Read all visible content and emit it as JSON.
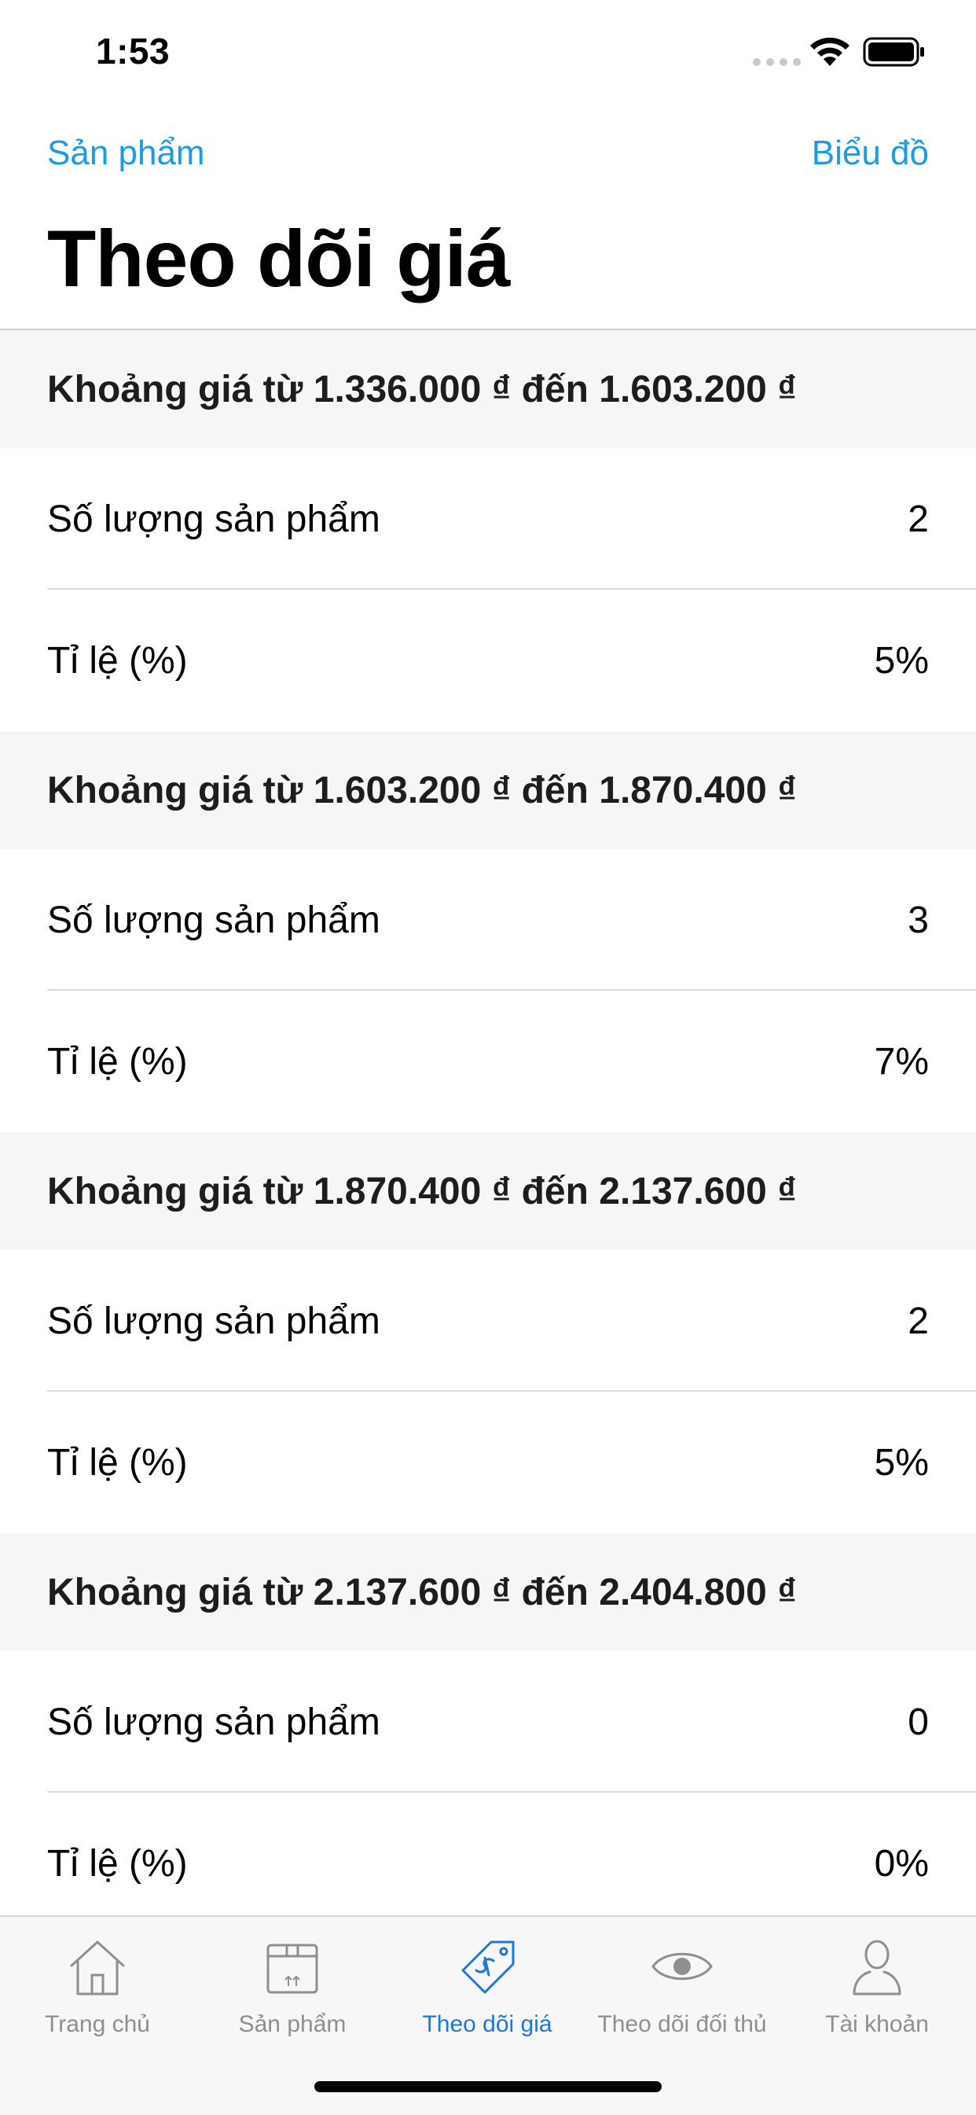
{
  "status": {
    "time": "1:53"
  },
  "nav": {
    "left_label": "Sản phẩm",
    "right_label": "Biểu đồ"
  },
  "page": {
    "title": "Theo dõi giá"
  },
  "sections": [
    {
      "header": "Khoảng giá từ 1.336.000 ₫ đến 1.603.200 ₫",
      "rows": [
        {
          "label": "Số lượng sản phẩm",
          "value": "2"
        },
        {
          "label": "Tỉ lệ (%)",
          "value": "5%"
        }
      ]
    },
    {
      "header": "Khoảng giá từ 1.603.200 ₫ đến 1.870.400 ₫",
      "rows": [
        {
          "label": "Số lượng sản phẩm",
          "value": "3"
        },
        {
          "label": "Tỉ lệ (%)",
          "value": "7%"
        }
      ]
    },
    {
      "header": "Khoảng giá từ 1.870.400 ₫ đến 2.137.600 ₫",
      "rows": [
        {
          "label": "Số lượng sản phẩm",
          "value": "2"
        },
        {
          "label": "Tỉ lệ (%)",
          "value": "5%"
        }
      ]
    },
    {
      "header": "Khoảng giá từ 2.137.600 ₫ đến 2.404.800 ₫",
      "rows": [
        {
          "label": "Số lượng sản phẩm",
          "value": "0"
        },
        {
          "label": "Tỉ lệ (%)",
          "value": "0%"
        }
      ]
    }
  ],
  "tabs": [
    {
      "label": "Trang chủ",
      "icon": "home-icon",
      "active": false
    },
    {
      "label": "Sản phẩm",
      "icon": "box-icon",
      "active": false
    },
    {
      "label": "Theo dõi giá",
      "icon": "price-tag-icon",
      "active": true
    },
    {
      "label": "Theo dõi đối thủ",
      "icon": "eye-icon",
      "active": false
    },
    {
      "label": "Tài khoản",
      "icon": "user-icon",
      "active": false
    }
  ],
  "colors": {
    "accent": "#1e9be5",
    "active_tab": "#1e78d8",
    "inactive_tab": "#8e8e93",
    "section_background": "#f6f6f7"
  }
}
